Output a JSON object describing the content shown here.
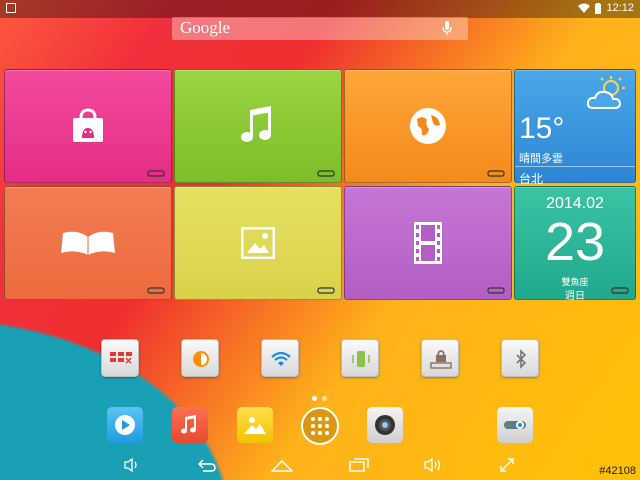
{
  "status": {
    "time": "12:12"
  },
  "search": {
    "brand": "Google"
  },
  "tiles": {
    "weather": {
      "temp": "15°",
      "desc": "晴間多雲",
      "city": "台北"
    },
    "calendar": {
      "year_month": "2014.02",
      "day": "23",
      "sign": "雙魚座",
      "weekday": "週日"
    }
  },
  "watermark": "#42108"
}
